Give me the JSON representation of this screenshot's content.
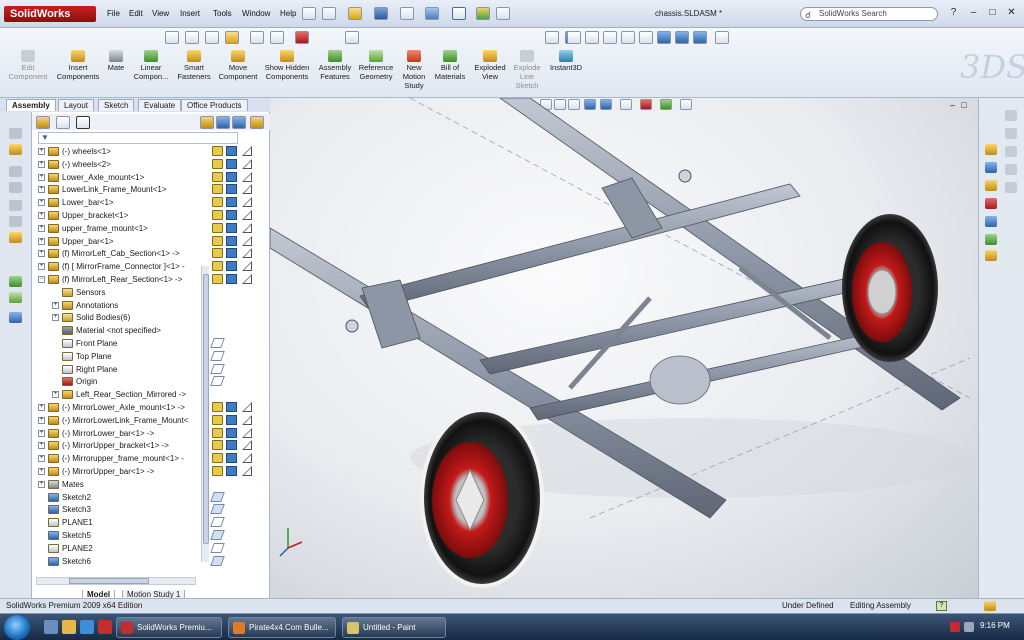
{
  "app": {
    "name": "SolidWorks",
    "document_title": "chassis.SLDASM *"
  },
  "menu": [
    "File",
    "Edit",
    "View",
    "Insert",
    "Tools",
    "Window",
    "Help"
  ],
  "search": {
    "placeholder": "SolidWorks Search"
  },
  "ribbon": [
    {
      "label": "Edit Component",
      "enabled": false
    },
    {
      "label": "Insert Components",
      "enabled": true
    },
    {
      "label": "Mate",
      "enabled": true
    },
    {
      "label": "Linear Compon...",
      "enabled": true
    },
    {
      "label": "Smart Fasteners",
      "enabled": true
    },
    {
      "label": "Move Component",
      "enabled": true
    },
    {
      "label": "Show Hidden Components",
      "enabled": true
    },
    {
      "label": "Assembly Features",
      "enabled": true
    },
    {
      "label": "Reference Geometry",
      "enabled": true
    },
    {
      "label": "New Motion Study",
      "enabled": true
    },
    {
      "label": "Bill of Materials",
      "enabled": true
    },
    {
      "label": "Exploded View",
      "enabled": true
    },
    {
      "label": "Explode Line Sketch",
      "enabled": false
    },
    {
      "label": "Instant3D",
      "enabled": true
    }
  ],
  "command_tabs": [
    "Assembly",
    "Layout",
    "Sketch",
    "Evaluate",
    "Office Products"
  ],
  "active_command_tab": "Assembly",
  "tree": [
    {
      "label": "(-) wheels<1>",
      "level": 0,
      "kind": "part",
      "status": true
    },
    {
      "label": "(-) wheels<2>",
      "level": 0,
      "kind": "part",
      "status": true
    },
    {
      "label": "Lower_Axle_mount<1>",
      "level": 0,
      "kind": "part",
      "status": true
    },
    {
      "label": "LowerLink_Frame_Mount<1>",
      "level": 0,
      "kind": "part",
      "status": true
    },
    {
      "label": "Lower_bar<1>",
      "level": 0,
      "kind": "part",
      "status": true
    },
    {
      "label": "Upper_bracket<1>",
      "level": 0,
      "kind": "part",
      "status": true
    },
    {
      "label": "upper_frame_mount<1>",
      "level": 0,
      "kind": "part",
      "status": true
    },
    {
      "label": "Upper_bar<1>",
      "level": 0,
      "kind": "part",
      "status": true
    },
    {
      "label": "(f) MirrorLeft_Cab_Section<1> ->",
      "level": 0,
      "kind": "part",
      "status": true
    },
    {
      "label": "(f) [ MirrorFrame_Connector ]<1> -",
      "level": 0,
      "kind": "part",
      "status": true
    },
    {
      "label": "(f) MirrorLeft_Rear_Section<1> ->",
      "level": 0,
      "kind": "part",
      "status": true,
      "expanded": true
    },
    {
      "label": "Sensors",
      "level": 1,
      "kind": "folder"
    },
    {
      "label": "Annotations",
      "level": 1,
      "kind": "annot"
    },
    {
      "label": "Solid Bodies(6)",
      "level": 1,
      "kind": "folder"
    },
    {
      "label": "Material <not specified>",
      "level": 1,
      "kind": "material"
    },
    {
      "label": "Front Plane",
      "level": 1,
      "kind": "plane"
    },
    {
      "label": "Top Plane",
      "level": 1,
      "kind": "plane"
    },
    {
      "label": "Right Plane",
      "level": 1,
      "kind": "plane"
    },
    {
      "label": "Origin",
      "level": 1,
      "kind": "origin"
    },
    {
      "label": "Left_Rear_Section_Mirrored ->",
      "level": 1,
      "kind": "feature"
    },
    {
      "label": "(-) MirrorLower_Axle_mount<1> ->",
      "level": 0,
      "kind": "part",
      "status": true
    },
    {
      "label": "(-) MirrorLowerLink_Frame_Mount<",
      "level": 0,
      "kind": "part",
      "status": true
    },
    {
      "label": "(-) MirrorLower_bar<1> ->",
      "level": 0,
      "kind": "part",
      "status": true
    },
    {
      "label": "(-) MirrorUpper_bracket<1> ->",
      "level": 0,
      "kind": "part",
      "status": true
    },
    {
      "label": "(-) Mirrorupper_frame_mount<1> -",
      "level": 0,
      "kind": "part",
      "status": true
    },
    {
      "label": "(-) MirrorUpper_bar<1> ->",
      "level": 0,
      "kind": "part",
      "status": true
    },
    {
      "label": "Mates",
      "level": 0,
      "kind": "mates"
    },
    {
      "label": "Sketch2",
      "level": 0,
      "kind": "sketch"
    },
    {
      "label": "Sketch3",
      "level": 0,
      "kind": "sketch"
    },
    {
      "label": "PLANE1",
      "level": 0,
      "kind": "plane"
    },
    {
      "label": "Sketch5",
      "level": 0,
      "kind": "sketch"
    },
    {
      "label": "PLANE2",
      "level": 0,
      "kind": "plane"
    },
    {
      "label": "Sketch6",
      "level": 0,
      "kind": "sketch"
    }
  ],
  "panel_tabs": [
    "Model",
    "Motion Study 1"
  ],
  "active_panel_tab": "Model",
  "status": {
    "edition": "SolidWorks Premium 2009 x64 Edition",
    "state": "Under Defined",
    "mode": "Editing Assembly"
  },
  "taskbar": {
    "tasks": [
      "SolidWorks Premiu...",
      "Pirate4x4.Com Bulle...",
      "Untitled - Paint"
    ],
    "clock": "9:16 PM"
  },
  "colors": {
    "wheel_rim": "#c21a1a",
    "frame": "#8f98a8",
    "accent": "#1f5fa8"
  }
}
